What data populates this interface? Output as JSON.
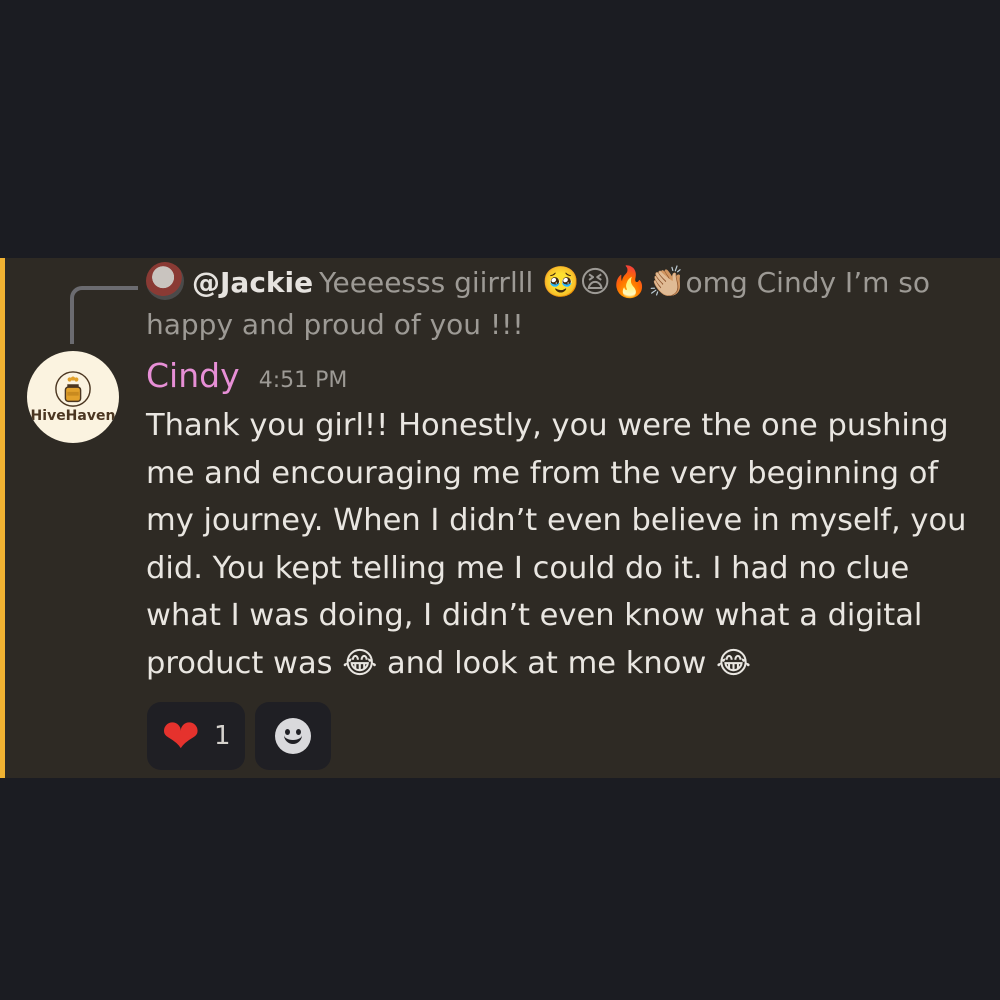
{
  "reply": {
    "user": "@Jackie",
    "text_part1": "Yeeeesss giirrlll ",
    "emojis": "🥹😫🔥👏🏼",
    "text_part2": "omg  Cindy I’m so",
    "text_line2": "happy and proud of you !!!"
  },
  "avatar": {
    "brand": "HiveHaven"
  },
  "message": {
    "author": "Cindy",
    "author_color": "#e78fd6",
    "timestamp": "4:51 PM",
    "lines": [
      "Thank you girl!! Honestly, you were the one pushing",
      "me and encouraging me from the very beginning of",
      "my journey. When I didn’t even believe in myself, you",
      "did. You kept telling me I could do it. I had no clue",
      "what I was doing, I didn’t even know what a digital"
    ],
    "last_line_a": "product was ",
    "last_line_emoji_a": "😂",
    "last_line_b": " and look at me know ",
    "last_line_emoji_b": "😂"
  },
  "reactions": {
    "heart_icon": "❤",
    "heart_count": "1",
    "add_reaction_icon": "smiley-add-reaction-icon"
  },
  "colors": {
    "background": "#1b1c22",
    "highlight": "#2e2a24",
    "accent_bar": "#f0b232"
  }
}
